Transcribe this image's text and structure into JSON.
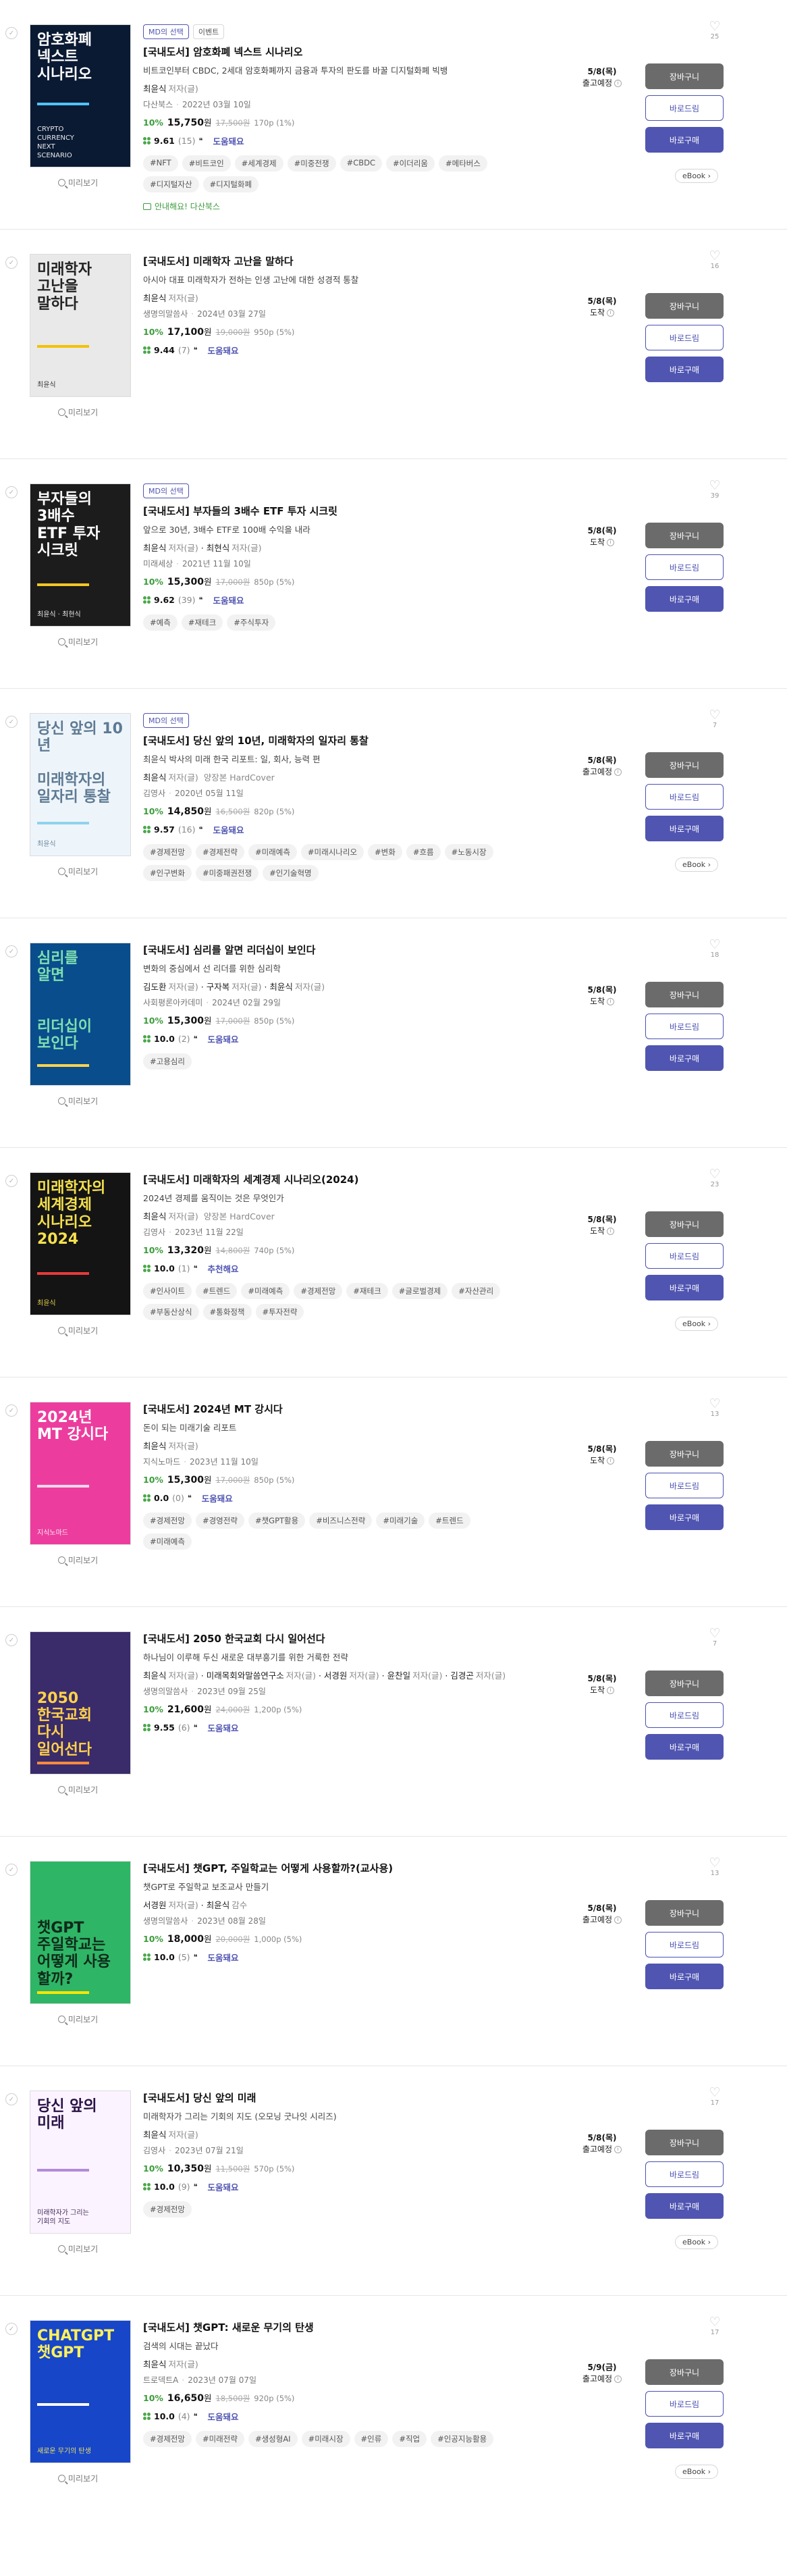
{
  "labels": {
    "preview": "미리보기",
    "cart": "장바구니",
    "gift": "바로드림",
    "buy": "바로구매",
    "ebook": "eBook",
    "review": "도움돼요",
    "review_recommend": "추천해요"
  },
  "books": [
    {
      "heart_count": "25",
      "badges": [
        "MD의 선택",
        "이벤트"
      ],
      "title": "[국내도서] 암호화폐 넥스트 시나리오",
      "subtitle": "비트코인부터 CBDC, 2세대 암호화폐까지 금융과 투자의 판도를 바꿀 디지털화폐 빅뱅",
      "authors": [
        {
          "name": "최윤식",
          "role": "저자(글)"
        }
      ],
      "publisher": "다산북스",
      "date": "2022년 03월 10일",
      "rate": "10%",
      "price": "15,750",
      "original": "17,500원",
      "points": "170p (1%)",
      "score": "9.61",
      "count": "(15)",
      "review_label": "aligned",
      "tags": [
        "#NFT",
        "#비트코인",
        "#세계경제",
        "#미중전쟁",
        "#CBDC",
        "#이더리움",
        "#메타버스",
        "#디지털자산",
        "#디지털화폐"
      ],
      "notice": "안내해요! 다산북스",
      "ship_date": "5/8(목)",
      "ship_status": "출고예정",
      "ebook": true,
      "cover": {
        "bg": "#0b1a33",
        "fg": "#ffffff",
        "accent": "#4fc3ff",
        "title": "암호화폐\n넥스트\n시나리오",
        "sub": "CRYPTO\nCURRENCY\nNEXT\nSCENARIO"
      }
    },
    {
      "heart_count": "16",
      "badges": [],
      "title": "[국내도서] 미래학자 고난을 말하다",
      "subtitle": "아시아 대표 미래학자가 전하는 인생 고난에 대한 성경적 통찰",
      "authors": [
        {
          "name": "최윤식",
          "role": "저자(글)"
        }
      ],
      "publisher": "생명의말씀사",
      "date": "2024년 03월 27일",
      "rate": "10%",
      "price": "17,100",
      "original": "19,000원",
      "points": "950p (5%)",
      "score": "9.44",
      "count": "(7)",
      "tags": [],
      "notice": "",
      "ship_date": "5/8(목)",
      "ship_status": "도착",
      "ebook": false,
      "cover": {
        "bg": "#e9e9e9",
        "fg": "#222222",
        "accent": "#f2c200",
        "title": "미래학자\n고난을\n말하다",
        "sub": "최윤식"
      }
    },
    {
      "heart_count": "39",
      "badges": [
        "MD의 선택"
      ],
      "title": "[국내도서] 부자들의 3배수 ETF 투자 시크릿",
      "subtitle": "앞으로 30년, 3배수 ETF로 100배 수익을 내라",
      "authors": [
        {
          "name": "최윤식",
          "role": "저자(글)"
        },
        {
          "name": "최현식",
          "role": "저자(글)"
        }
      ],
      "publisher": "미래세상",
      "date": "2021년 11월 10일",
      "rate": "10%",
      "price": "15,300",
      "original": "17,000원",
      "points": "850p (5%)",
      "score": "9.62",
      "count": "(39)",
      "tags": [
        "#예측",
        "#재테크",
        "#주식투자"
      ],
      "notice": "",
      "ship_date": "5/8(목)",
      "ship_status": "도착",
      "ebook": false,
      "cover": {
        "bg": "#1c1c1c",
        "fg": "#ffffff",
        "accent": "#f3c623",
        "title": "부자들의\n3배수\nETF 투자\n시크릿",
        "sub": "최윤식 · 최현식"
      }
    },
    {
      "heart_count": "7",
      "badges": [
        "MD의 선택"
      ],
      "title": "[국내도서] 당신 앞의 10년, 미래학자의 일자리 통찰",
      "subtitle": "최윤식 박사의 미래 한국 리포트: 일, 회사, 능력 편",
      "authors": [
        {
          "name": "최윤식",
          "role": "저자(글)"
        }
      ],
      "extra": "양장본 HardCover",
      "publisher": "김영사",
      "date": "2020년 05월 11일",
      "rate": "10%",
      "price": "14,850",
      "original": "16,500원",
      "points": "820p (5%)",
      "score": "9.57",
      "count": "(16)",
      "tags": [
        "#경제전망",
        "#경제전략",
        "#미래예측",
        "#미래시나리오",
        "#변화",
        "#흐름",
        "#노동시장",
        "#인구변화",
        "#미중패권전쟁",
        "#인기술혁명"
      ],
      "notice": "",
      "ship_date": "5/8(목)",
      "ship_status": "출고예정",
      "ebook": true,
      "cover": {
        "bg": "#eef5fa",
        "fg": "#5e7a93",
        "accent": "#8ed3ec",
        "title": "당신 앞의 10년\n\n미래학자의\n일자리 통찰",
        "sub": "최윤식"
      }
    },
    {
      "heart_count": "18",
      "badges": [],
      "title": "[국내도서] 심리를 알면 리더십이 보인다",
      "subtitle": "변화의 중심에서 선 리더를 위한 심리학",
      "authors": [
        {
          "name": "김도환",
          "role": "저자(글)"
        },
        {
          "name": "구자복",
          "role": "저자(글)"
        },
        {
          "name": "최윤식",
          "role": "저자(글)"
        }
      ],
      "publisher": "사회평론아카데미",
      "date": "2024년 02월 29일",
      "rate": "10%",
      "price": "15,300",
      "original": "17,000원",
      "points": "850p (5%)",
      "score": "10.0",
      "count": "(2)",
      "tags": [
        "#고용심리"
      ],
      "notice": "",
      "ship_date": "5/8(목)",
      "ship_status": "도착",
      "ebook": false,
      "cover": {
        "bg": "#0a4d8c",
        "fg": "#7ee0b0",
        "accent": "#ffd44d",
        "title": "심리를\n알면\n\n\n리더십이\n보인다",
        "sub": ""
      }
    },
    {
      "heart_count": "23",
      "badges": [],
      "title": "[국내도서] 미래학자의 세계경제 시나리오(2024)",
      "subtitle": "2024년 경제를 움직이는 것은 무엇인가",
      "authors": [
        {
          "name": "최윤식",
          "role": "저자(글)"
        }
      ],
      "extra": "양장본 HardCover",
      "publisher": "김영사",
      "date": "2023년 11월 22일",
      "rate": "10%",
      "price": "13,320",
      "original": "14,800원",
      "points": "740p (5%)",
      "score": "10.0",
      "count": "(1)",
      "recommend": true,
      "tags": [
        "#인사이트",
        "#트렌드",
        "#미래예측",
        "#경제전망",
        "#재테크",
        "#글로벌경제",
        "#자산관리",
        "#부동산상식",
        "#통화정책",
        "#투자전략"
      ],
      "notice": "",
      "ship_date": "5/8(목)",
      "ship_status": "도착",
      "ebook": true,
      "cover": {
        "bg": "#141414",
        "fg": "#f4e04d",
        "accent": "#e83a3a",
        "title": "미래학자의\n세계경제\n시나리오\n2024",
        "sub": "최윤식"
      }
    },
    {
      "heart_count": "13",
      "badges": [],
      "title": "[국내도서] 2024년 MT 강시다",
      "subtitle": "돈이 되는 미래기술 리포트",
      "authors": [
        {
          "name": "최윤식",
          "role": "저자(글)"
        }
      ],
      "publisher": "지식노마드",
      "date": "2023년 11월 10일",
      "rate": "10%",
      "price": "15,300",
      "original": "17,000원",
      "points": "850p (5%)",
      "score": "0.0",
      "count": "(0)",
      "no_review": true,
      "tags": [
        "#경제전망",
        "#경영전략",
        "#챗GPT활용",
        "#비즈니스전략",
        "#미래기술",
        "#트렌드",
        "#미래예측"
      ],
      "notice": "",
      "ship_date": "5/8(목)",
      "ship_status": "도착",
      "ebook": false,
      "cover": {
        "bg": "#ec3d9e",
        "fg": "#ffffff",
        "accent": "#fcd7ec",
        "title": "2024년\nMT 강시다",
        "sub": "지식노마드"
      }
    },
    {
      "heart_count": "7",
      "badges": [],
      "title": "[국내도서] 2050 한국교회 다시 일어선다",
      "subtitle": "하나님이 이루해 두신 새로운 대부흥기를 위한 거룩한 전략",
      "authors": [
        {
          "name": "최윤식",
          "role": "저자(글)"
        },
        {
          "name": "미래목회와말씀연구소",
          "role": "저자(글)"
        },
        {
          "name": "서경원",
          "role": "저자(글)"
        },
        {
          "name": "윤찬일",
          "role": "저자(글)"
        },
        {
          "name": "김경곤",
          "role": "저자(글)"
        }
      ],
      "publisher": "생명의말씀사",
      "date": "2023년 09월 25일",
      "rate": "10%",
      "price": "21,600",
      "original": "24,000원",
      "points": "1,200p (5%)",
      "score": "9.55",
      "count": "(6)",
      "tags": [],
      "notice": "",
      "ship_date": "5/8(목)",
      "ship_status": "도착",
      "ebook": false,
      "cover": {
        "bg": "#3a2b6b",
        "fg": "#ffd24a",
        "accent": "#ff8a3d",
        "title": "\n\n\n2050\n한국교회\n다시\n일어선다",
        "sub": ""
      }
    },
    {
      "heart_count": "13",
      "badges": [],
      "title": "[국내도서] 챗GPT, 주일학교는 어떻게 사용할까?(교사용)",
      "subtitle": "챗GPT로 주일학교 보조교사 만들기",
      "authors": [
        {
          "name": "서경원",
          "role": "저자(글)"
        },
        {
          "name": "최윤식",
          "role": "감수"
        }
      ],
      "publisher": "생명의말씀사",
      "date": "2023년 08월 28일",
      "rate": "10%",
      "price": "18,000",
      "original": "20,000원",
      "points": "1,000p (5%)",
      "score": "10.0",
      "count": "(5)",
      "tags": [],
      "notice": "",
      "ship_date": "5/8(목)",
      "ship_status": "출고예정",
      "ebook": false,
      "cover": {
        "bg": "#2fb566",
        "fg": "#0e2a1a",
        "accent": "#ffe600",
        "title": "\n\n\n챗GPT\n주일학교는\n어떻게 사용할까?",
        "sub": ""
      }
    },
    {
      "heart_count": "17",
      "badges": [],
      "title": "[국내도서] 당신 앞의 미래",
      "subtitle": "미래학자가 그리는 기회의 지도 (오모닝 굿나잇 시리즈)",
      "authors": [
        {
          "name": "최윤식",
          "role": "저자(글)"
        }
      ],
      "publisher": "김영사",
      "date": "2023년 07월 21일",
      "rate": "10%",
      "price": "10,350",
      "original": "11,500원",
      "points": "570p (5%)",
      "score": "10.0",
      "count": "(9)",
      "tags": [
        "#경제전망"
      ],
      "notice": "",
      "ship_date": "5/8(목)",
      "ship_status": "출고예정",
      "ebook": true,
      "cover": {
        "bg": "#fbf3ff",
        "fg": "#2a1245",
        "accent": "#b38ad8",
        "title": "당신 앞의\n미래",
        "sub": "미래학자가 그리는\n기회의 지도"
      }
    },
    {
      "heart_count": "17",
      "badges": [],
      "title": "[국내도서] 챗GPT: 새로운 무기의 탄생",
      "subtitle": "검색의 시대는 끝났다",
      "authors": [
        {
          "name": "최윤식",
          "role": "저자(글)"
        }
      ],
      "publisher": "트로덱트A",
      "date": "2023년 07월 07일",
      "rate": "10%",
      "price": "16,650",
      "original": "18,500원",
      "points": "920p (5%)",
      "score": "10.0",
      "count": "(4)",
      "tags": [
        "#경제전망",
        "#미래전략",
        "#생성형AI",
        "#미래시장",
        "#인류",
        "#직업",
        "#인공지능활용"
      ],
      "notice": "",
      "ship_date": "5/9(금)",
      "ship_status": "출고예정",
      "ebook": true,
      "cover": {
        "bg": "#1846c8",
        "fg": "#fff15a",
        "accent": "#ffffff",
        "title": "CHATGPT\n챗GPT",
        "sub": "새로운 무기의 탄생"
      }
    }
  ]
}
